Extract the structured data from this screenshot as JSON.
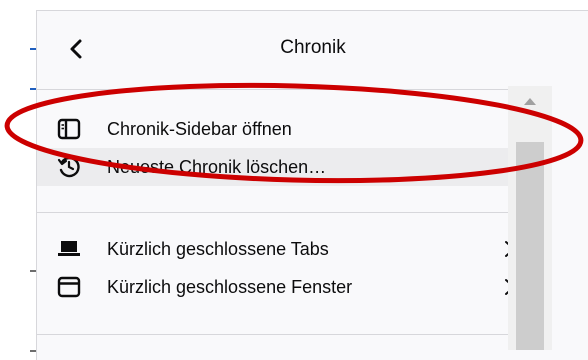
{
  "panel": {
    "title": "Chronik",
    "back_icon": "chevron-left-icon"
  },
  "menu": {
    "items": [
      {
        "label": "Chronik-Sidebar öffnen",
        "icon": "sidebar-icon"
      },
      {
        "label": "Neueste Chronik löschen…",
        "icon": "history-clear-icon",
        "hovered": true
      },
      {
        "label": "Kürzlich geschlossene Tabs",
        "icon": "tab-icon",
        "submenu": true
      },
      {
        "label": "Kürzlich geschlossene Fenster",
        "icon": "window-icon",
        "submenu": true
      }
    ]
  },
  "annotation": {
    "shape": "ellipse",
    "color": "#cc0000"
  }
}
